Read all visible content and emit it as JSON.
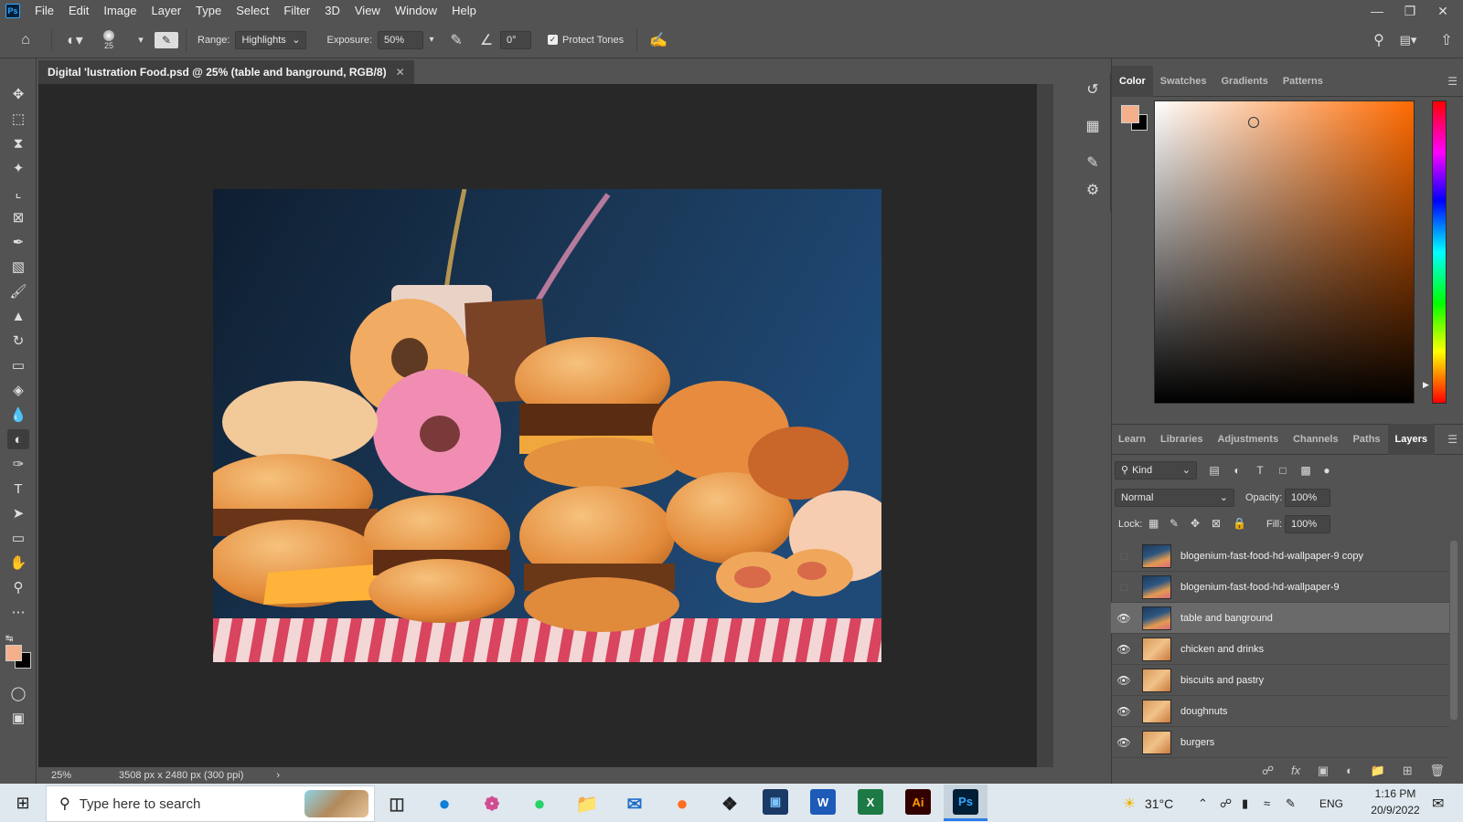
{
  "menubar": {
    "app_logo": "Ps",
    "items": [
      "File",
      "Edit",
      "Image",
      "Layer",
      "Type",
      "Select",
      "Filter",
      "3D",
      "View",
      "Window",
      "Help"
    ]
  },
  "options": {
    "brush_size": "25",
    "range_label": "Range:",
    "range_value": "Highlights",
    "exposure_label": "Exposure:",
    "exposure_value": "50%",
    "angle_value": "0°",
    "protect_tones": "Protect Tones"
  },
  "document": {
    "tab_title": "Digital 'lustration Food.psd @ 25% (table and banground, RGB/8)",
    "zoom": "25%",
    "doc_info": "3508 px x 2480 px (300 ppi)"
  },
  "color_panel": {
    "tabs": [
      "Color",
      "Swatches",
      "Gradients",
      "Patterns"
    ],
    "foreground": "#f4b08a",
    "background": "#000000"
  },
  "layers_panel": {
    "tabs": [
      "Learn",
      "Libraries",
      "Adjustments",
      "Channels",
      "Paths",
      "Layers"
    ],
    "filter_kind": "Kind",
    "blend_mode": "Normal",
    "opacity_label": "Opacity:",
    "opacity_value": "100%",
    "lock_label": "Lock:",
    "fill_label": "Fill:",
    "fill_value": "100%",
    "layers": [
      {
        "name": "blogenium-fast-food-hd-wallpaper-9 copy",
        "visible": false
      },
      {
        "name": "blogenium-fast-food-hd-wallpaper-9",
        "visible": false
      },
      {
        "name": "table and banground",
        "visible": true,
        "selected": true
      },
      {
        "name": "chicken and drinks",
        "visible": true
      },
      {
        "name": "biscuits and pastry",
        "visible": true
      },
      {
        "name": "doughnuts",
        "visible": true
      },
      {
        "name": "burgers",
        "visible": true
      }
    ]
  },
  "taskbar": {
    "search_placeholder": "Type here to search",
    "weather": "31°C",
    "language": "ENG",
    "time": "1:16 PM",
    "date": "20/9/2022"
  }
}
